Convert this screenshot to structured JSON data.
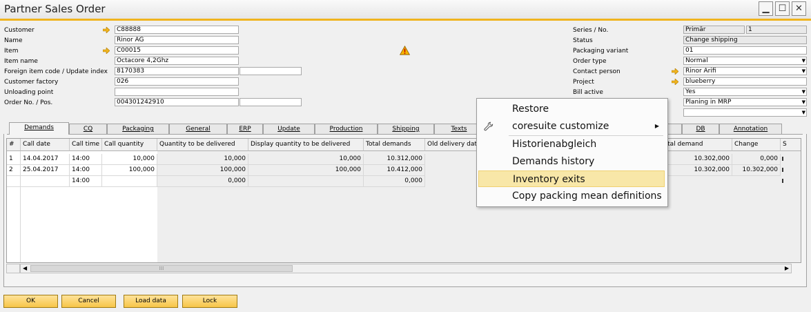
{
  "window": {
    "title": "Partner Sales Order"
  },
  "form_left": [
    {
      "label": "Customer",
      "value": "C88888",
      "arrow": true
    },
    {
      "label": "Name",
      "value": "Rinor AG",
      "arrow": false
    },
    {
      "label": "Item",
      "value": "C00015",
      "arrow": true
    },
    {
      "label": "Item name",
      "value": "Octacore 4,2Ghz",
      "arrow": false
    },
    {
      "label": "Foreign item code / Update index",
      "value": "8170383",
      "value2": "",
      "arrow": false
    },
    {
      "label": "Customer factory",
      "value": "026",
      "arrow": false
    },
    {
      "label": "Unloading point",
      "value": "",
      "arrow": false
    },
    {
      "label": "Order No. / Pos.",
      "value": "004301242910",
      "value2": "",
      "arrow": false
    }
  ],
  "form_right": [
    {
      "label": "Series / No.",
      "value": "Primär",
      "value2": "1"
    },
    {
      "label": "Status",
      "value": "Change shipping"
    },
    {
      "label": "Packaging variant",
      "value": "01"
    },
    {
      "label": "Order type",
      "value": "Normal",
      "dropdown": true
    },
    {
      "label": "Contact person",
      "value": "Rinor Arifi",
      "arrow": true
    },
    {
      "label": "Project",
      "value": "blueberry",
      "arrow": true
    },
    {
      "label": "Bill active",
      "value": "Yes",
      "dropdown": true
    },
    {
      "label": "",
      "value": "Planing in MRP",
      "dropdown": true
    },
    {
      "label": "",
      "value": "",
      "dropdown": true
    }
  ],
  "tabs": [
    "Demands",
    "CQ",
    "Packaging",
    "General",
    "ERP",
    "Update",
    "Production",
    "Shipping",
    "Texts",
    "DB",
    "Annotation"
  ],
  "grid": {
    "columns": [
      "#",
      "Call date",
      "Call time",
      "Call quantity",
      "Quantity to be delivered",
      "Display quantity to be delivered",
      "Total demands",
      "Old delivery date",
      "ge total demand",
      "Change",
      "S"
    ],
    "rows": [
      [
        "1",
        "14.04.2017",
        "14:00",
        "10,000",
        "10,000",
        "10,000",
        "10.312,000",
        "",
        "10.302,000",
        "0,000",
        ""
      ],
      [
        "2",
        "25.04.2017",
        "14:00",
        "100,000",
        "100,000",
        "100,000",
        "10.412,000",
        "",
        "10.302,000",
        "10.302,000",
        ""
      ],
      [
        "",
        "",
        "14:00",
        "",
        "0,000",
        "",
        "0,000",
        "",
        "",
        "",
        ""
      ]
    ],
    "scroll_grip": "⁞⁞⁞"
  },
  "context_menu": {
    "items": [
      "Restore",
      "coresuite customize",
      "Historienabgleich",
      "Demands history",
      "Inventory exits",
      "Copy packing mean definitions"
    ],
    "highlighted": "Inventory exits"
  },
  "buttons": [
    "OK",
    "Cancel",
    "Load data",
    "Lock"
  ],
  "icons": {
    "warning": "warning-icon",
    "wrench": "wrench-icon"
  },
  "colors": {
    "accent": "#f0b41e",
    "button": "#f7c548",
    "highlight": "#f8e7a8"
  }
}
